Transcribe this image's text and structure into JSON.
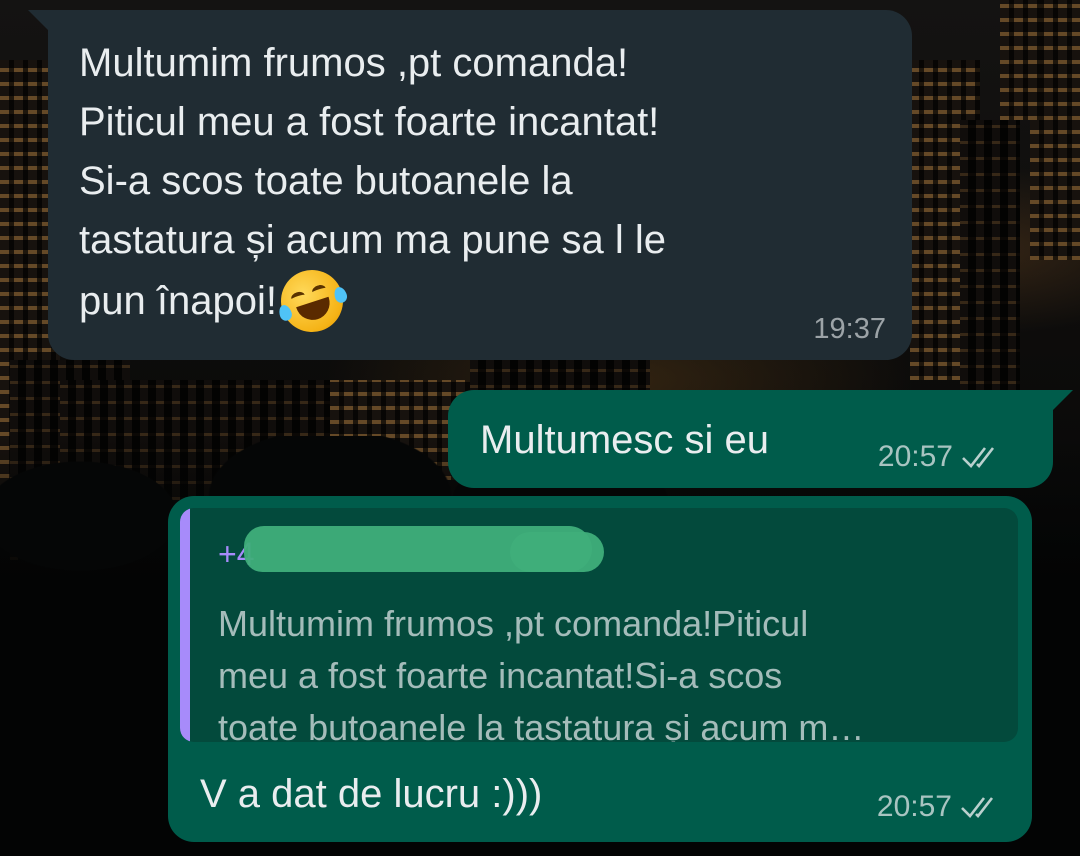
{
  "chat": {
    "messages": [
      {
        "direction": "incoming",
        "lines": [
          "Multumim frumos ,pt comanda!",
          "Piticul meu a fost foarte incantat!",
          "Si-a scos toate butoanele la",
          "tastatura și acum ma pune sa l le",
          "pun înapoi!"
        ],
        "emoji": "rolling-on-floor-laughing",
        "time": "19:37"
      },
      {
        "direction": "outgoing",
        "text": "Multumesc si eu",
        "time": "20:57",
        "status": "read"
      },
      {
        "direction": "outgoing",
        "quote": {
          "author": "+4",
          "lines": [
            "Multumim frumos ,pt comanda!Piticul",
            "meu a fost foarte incantat!Si-a scos",
            "toate butoanele la tastatura și acum m…"
          ],
          "accent_color": "#a78bfa"
        },
        "text": "V a dat de lucru :)))",
        "time": "20:57",
        "status": "read"
      }
    ]
  },
  "colors": {
    "incoming_bubble": "#202c33",
    "outgoing_bubble": "#005c4b",
    "quote_background": "#034a3c",
    "redaction": "#3fae7a"
  }
}
